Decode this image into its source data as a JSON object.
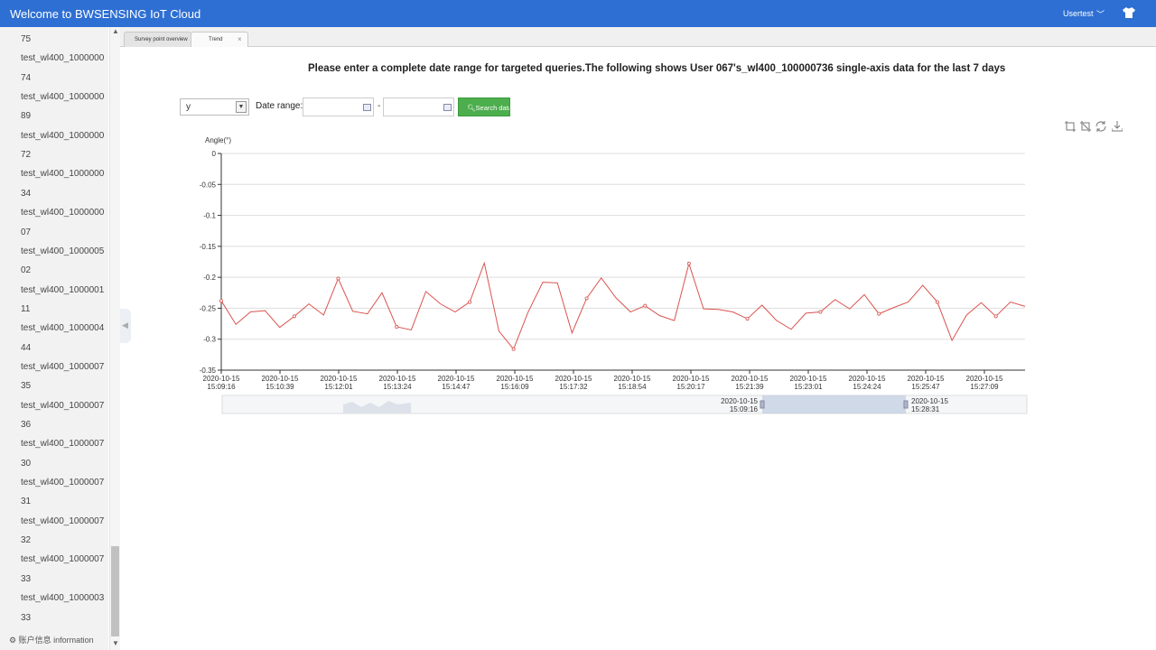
{
  "header": {
    "title": "Welcome to BWSENSING IoT Cloud",
    "user_label": "Usertest",
    "user_chevron": "﹀",
    "shirt_icon": "shirt-icon"
  },
  "sidebar": {
    "lines": [
      "75",
      "test_wl400_1000000",
      "74",
      "test_wl400_1000000",
      "89",
      "test_wl400_1000000",
      "72",
      "test_wl400_1000000",
      "34",
      "test_wl400_1000000",
      "07",
      "test_wl400_1000005",
      "02",
      "test_wl400_1000001",
      "11",
      "test_wl400_1000004",
      "44",
      "test_wl400_1000007",
      "35",
      "test_wl400_1000007",
      "36",
      "test_wl400_1000007",
      "30",
      "test_wl400_1000007",
      "31",
      "test_wl400_1000007",
      "32",
      "test_wl400_1000007",
      "33",
      "test_wl400_1000003",
      "33"
    ],
    "footer": "账户信息 information"
  },
  "tabs": [
    {
      "label": "Survey point overview"
    },
    {
      "label": "Trend",
      "close": "×"
    }
  ],
  "heading": "Please enter a complete date range for targeted queries.The following shows User 067's_wl400_100000736 single-axis data for the last 7 days",
  "filters": {
    "axis_value": "y",
    "date_label": "Date range:",
    "separator": "-",
    "search_label": "Search data"
  },
  "colors": {
    "header": "#2e6fd3",
    "series": "#d9534f",
    "search": "#4cae4c"
  },
  "chart_data": {
    "type": "line",
    "ylabel": "Angle(°)",
    "ylim": [
      -0.35,
      0
    ],
    "yticks": [
      0,
      -0.05,
      -0.1,
      -0.15,
      -0.2,
      -0.25,
      -0.3,
      -0.35
    ],
    "ytick_labels": [
      "0",
      "-0.05",
      "-0.1",
      "-0.15",
      "-0.2",
      "-0.25",
      "-0.3",
      "-0.35"
    ],
    "xtick_labels": [
      [
        "2020-10-15",
        "15:09:16"
      ],
      [
        "2020-10-15",
        "15:10:39"
      ],
      [
        "2020-10-15",
        "15:12:01"
      ],
      [
        "2020-10-15",
        "15:13:24"
      ],
      [
        "2020-10-15",
        "15:14:47"
      ],
      [
        "2020-10-15",
        "15:16:09"
      ],
      [
        "2020-10-15",
        "15:17:32"
      ],
      [
        "2020-10-15",
        "15:18:54"
      ],
      [
        "2020-10-15",
        "15:20:17"
      ],
      [
        "2020-10-15",
        "15:21:39"
      ],
      [
        "2020-10-15",
        "15:23:01"
      ],
      [
        "2020-10-15",
        "15:24:24"
      ],
      [
        "2020-10-15",
        "15:25:47"
      ],
      [
        "2020-10-15",
        "15:27:09"
      ]
    ],
    "grid": true,
    "series": [
      {
        "values": [
          -0.238,
          -0.276,
          -0.256,
          -0.254,
          -0.281,
          -0.263,
          -0.243,
          -0.261,
          -0.202,
          -0.255,
          -0.259,
          -0.225,
          -0.28,
          -0.285,
          -0.223,
          -0.243,
          -0.256,
          -0.24,
          -0.177,
          -0.287,
          -0.316,
          -0.256,
          -0.208,
          -0.209,
          -0.29,
          -0.234,
          -0.201,
          -0.233,
          -0.256,
          -0.246,
          -0.262,
          -0.27,
          -0.178,
          -0.251,
          -0.252,
          -0.256,
          -0.267,
          -0.245,
          -0.27,
          -0.284,
          -0.258,
          -0.256,
          -0.236,
          -0.251,
          -0.228,
          -0.259,
          -0.249,
          -0.24,
          -0.213,
          -0.24,
          -0.302,
          -0.261,
          -0.241,
          -0.263,
          -0.24,
          -0.247
        ]
      }
    ],
    "zoom_start_label": [
      "2020-10-15",
      "15:09:16"
    ],
    "zoom_end_label": [
      "2020-10-15",
      "15:28:31"
    ]
  },
  "toolbox": {
    "icons": [
      "zoom-icon",
      "zoom-reset-icon",
      "restore-icon",
      "download-icon"
    ]
  }
}
